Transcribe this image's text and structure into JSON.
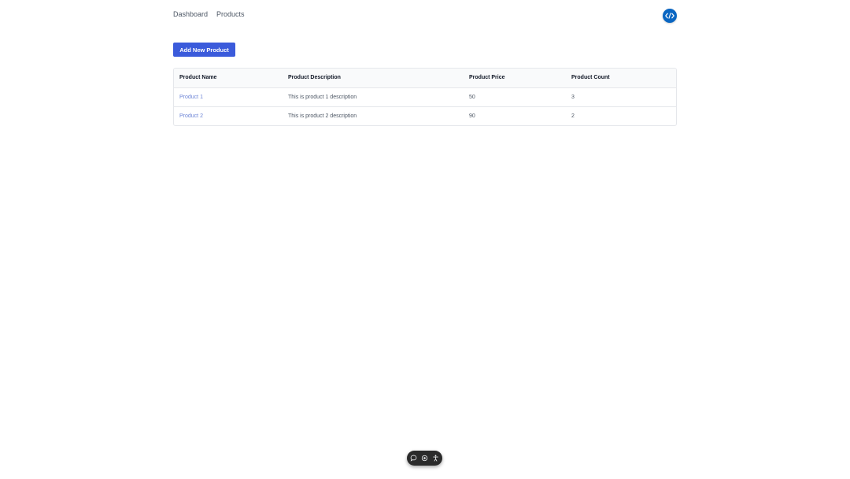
{
  "nav": {
    "items": [
      {
        "label": "Dashboard"
      },
      {
        "label": "Products"
      }
    ]
  },
  "dev_toggle": {
    "icon": "code-icon",
    "color": "#0a66c2"
  },
  "actions": {
    "add_product_label": "Add New Product",
    "accent": "#3b5bdb"
  },
  "table": {
    "headers": {
      "name": "Product Name",
      "description": "Product Description",
      "price": "Product Price",
      "count": "Product Count"
    },
    "rows": [
      {
        "name": "Product 1",
        "description": "This is product 1 description",
        "price": "50",
        "count": "3"
      },
      {
        "name": "Product 2",
        "description": "This is product 2 description",
        "price": "90",
        "count": "2"
      }
    ]
  },
  "toolbar": {
    "icons": [
      "comment-icon",
      "eye-icon",
      "accessibility-icon"
    ]
  }
}
